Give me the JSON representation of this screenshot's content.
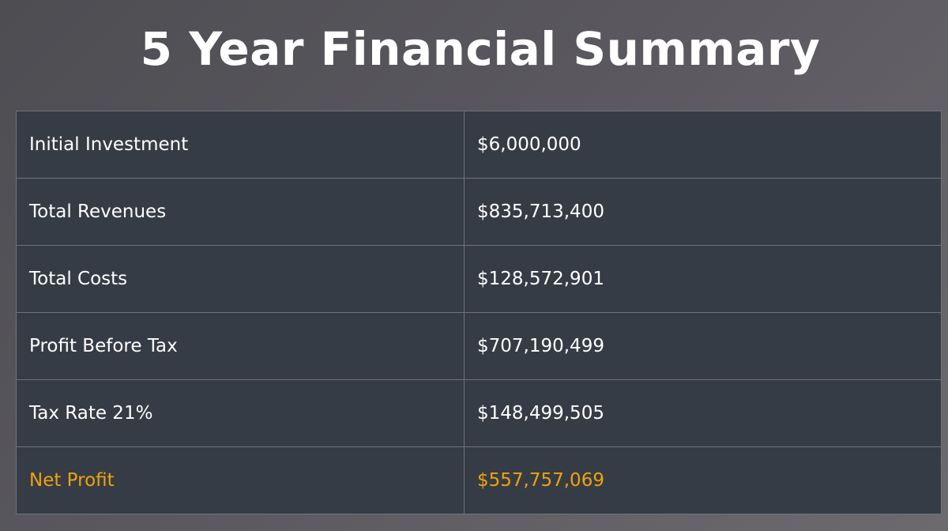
{
  "title": "5 Year Financial Summary",
  "colors": {
    "table_background": "#363c46",
    "highlight": "#f0a20a",
    "text": "#ffffff"
  },
  "rows": [
    {
      "label": "Initial Investment",
      "value": "$6,000,000"
    },
    {
      "label": "Total Revenues",
      "value": "$835,713,400"
    },
    {
      "label": "Total Costs",
      "value": "$128,572,901"
    },
    {
      "label": "Profit Before Tax",
      "value": "$707,190,499"
    },
    {
      "label": "Tax Rate 21%",
      "value": "$148,499,505"
    },
    {
      "label": "Net Profit",
      "value": "$557,757,069"
    }
  ]
}
